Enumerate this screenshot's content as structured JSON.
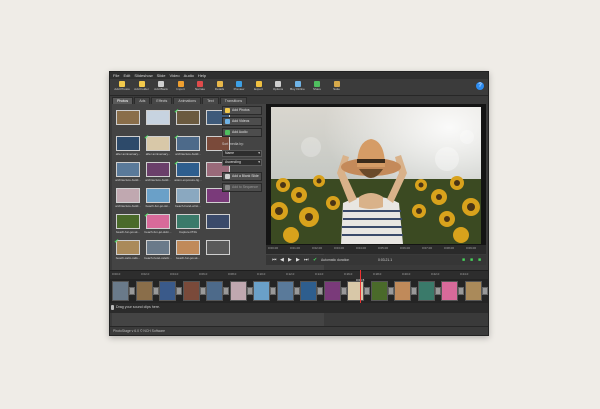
{
  "menu": [
    "File",
    "Edit",
    "Slideshow",
    "Slide",
    "Video",
    "Audio",
    "Help"
  ],
  "toolbar": {
    "buttons": [
      {
        "label": "Add Photos",
        "color": "#f2c94c"
      },
      {
        "label": "Add Folder",
        "color": "#f2c94c"
      },
      {
        "label": "Add Blank",
        "color": "#cfcfcf"
      },
      {
        "label": "Import",
        "color": "#f0a030"
      },
      {
        "label": "Narrate",
        "color": "#e04b4b"
      },
      {
        "label": "Details",
        "color": "#e9b84a"
      },
      {
        "label": "Preview",
        "color": "#3ca0e6"
      },
      {
        "label": "Export",
        "color": "#f0c040"
      },
      {
        "label": "Options",
        "color": "#cfcfcf"
      },
      {
        "label": "Buy Online",
        "color": "#6fb3e6"
      },
      {
        "label": "Share",
        "color": "#4fbf5f"
      },
      {
        "label": "Suite",
        "color": "#d6a94a"
      }
    ],
    "help_label": "?"
  },
  "tabs": [
    "Photos",
    "Ads",
    "Effects",
    "Animations",
    "Text",
    "Transitions"
  ],
  "media_items": [
    {
      "caption": "",
      "color": "#8a6e4a",
      "checked": false
    },
    {
      "caption": "",
      "color": "#c7d3e0",
      "checked": false
    },
    {
      "caption": "",
      "color": "#6b5a3f",
      "checked": true
    },
    {
      "caption": "",
      "color": "#3e5a7a",
      "checked": false
    },
    {
      "caption": "after anniversary...",
      "color": "#2d4a6a",
      "checked": false
    },
    {
      "caption": "after anniversary...",
      "color": "#d8c8a8",
      "checked": true
    },
    {
      "caption": "architecture-build...",
      "color": "#4d6a8a",
      "checked": true
    },
    {
      "caption": "",
      "color": "#7a4a3a",
      "checked": false
    },
    {
      "caption": "architecture-build...",
      "color": "#5a7a9a",
      "checked": false
    },
    {
      "caption": "architecture-build...",
      "color": "#6a3f6a",
      "checked": false
    },
    {
      "caption": "aston-exposure-lig...",
      "color": "#2e5e8e",
      "checked": true
    },
    {
      "caption": "",
      "color": "#9a6a7a",
      "checked": false
    },
    {
      "caption": "architecture-build...",
      "color": "#c0a8b0",
      "checked": false
    },
    {
      "caption": "beach-fun-jet-ski...",
      "color": "#6aa0c8",
      "checked": false
    },
    {
      "caption": "beach-hand-wrist...",
      "color": "#8aa8c0",
      "checked": false
    },
    {
      "caption": "",
      "color": "#7a3a7a",
      "checked": false
    },
    {
      "caption": "beach-fun-jet-sk...",
      "color": "#4a6a2a",
      "checked": false
    },
    {
      "caption": "beach-fun-jet-skiin...",
      "color": "#d86a9a",
      "checked": true
    },
    {
      "caption": "Capture.PNG",
      "color": "#3a7a6a",
      "checked": false
    },
    {
      "caption": "",
      "color": "#3a4a6a",
      "checked": false
    },
    {
      "caption": "beach-calm-rails...",
      "color": "#aa8a5a",
      "checked": true
    },
    {
      "caption": "beach-hotel-celebr...",
      "color": "#6a7a8a",
      "checked": false
    },
    {
      "caption": "beach-fun-jet-sk...",
      "color": "#c08a5a",
      "checked": false
    },
    {
      "caption": "",
      "color": "#5a5a5a",
      "checked": false
    }
  ],
  "side": {
    "add_photos": "Add Photos",
    "add_videos": "Add Videos",
    "add_audio": "Add Audio",
    "sort_label": "Sort media by:",
    "sort_value": "Name",
    "order_value": "Ascending",
    "blank_slide": "Add a Blank Slide",
    "add_to_sequence": "Add to Sequence"
  },
  "preview": {
    "ruler": [
      "0:00.00",
      "0:01.00",
      "0:02.00",
      "0:03.00",
      "0:04.00",
      "0:05.00",
      "0:06.00",
      "0:07.00",
      "0:08.00",
      "0:09.00"
    ],
    "autoplay_label": "Automatic duration",
    "time_display": "0:03.21.1"
  },
  "timeline": {
    "ruler": [
      "0:00.0",
      "0:02.0",
      "0:04.0",
      "0:06.0",
      "0:08.0",
      "0:10.0",
      "0:12.0",
      "0:14.0",
      "0:16.0",
      "0:18.0",
      "0:20.0",
      "0:22.0",
      "0:24.0"
    ],
    "selected_time": "0:05.5",
    "clips": [
      {
        "color": "#6a7a8a"
      },
      {
        "color": "#8a6e4a"
      },
      {
        "color": "#3a5a8a"
      },
      {
        "color": "#7a4a3a"
      },
      {
        "color": "#4d6a8a"
      },
      {
        "color": "#c0a8b0"
      },
      {
        "color": "#6aa0c8"
      },
      {
        "color": "#5a7a9a"
      },
      {
        "color": "#2e5e8e"
      },
      {
        "color": "#7a3a7a"
      },
      {
        "color": "#d8c8a8"
      },
      {
        "color": "#4a6a2a"
      },
      {
        "color": "#c08a5a"
      },
      {
        "color": "#3a7a6a"
      },
      {
        "color": "#d86a9a"
      },
      {
        "color": "#aa8a5a"
      }
    ],
    "sound_label": "Drag your sound clips here."
  },
  "status_text": "PhotoStage v 6.0 © NCH Software"
}
